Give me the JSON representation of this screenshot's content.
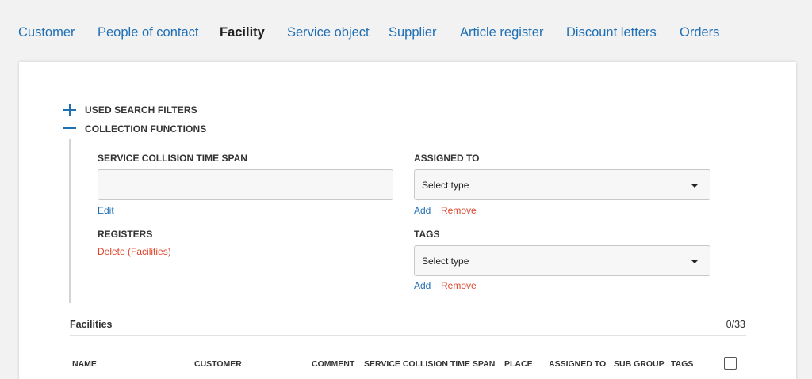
{
  "nav": {
    "tabs": [
      {
        "label": "Customer"
      },
      {
        "label": "People of contact"
      },
      {
        "label": "Facility"
      },
      {
        "label": "Service object"
      },
      {
        "label": "Supplier"
      },
      {
        "label": "Article register"
      },
      {
        "label": "Discount letters"
      },
      {
        "label": "Orders"
      }
    ],
    "active": "Facility"
  },
  "filters": {
    "used_search_filters": "USED SEARCH FILTERS",
    "collection_functions": "COLLECTION FUNCTIONS"
  },
  "collection": {
    "service_collision": {
      "label": "SERVICE COLLISION TIME SPAN",
      "value": "",
      "edit_link": "Edit"
    },
    "assigned_to": {
      "label": "ASSIGNED TO",
      "select_value": "Select type",
      "add": "Add",
      "remove": "Remove"
    },
    "registers": {
      "label": "REGISTERS",
      "delete_link": "Delete (Facilities)"
    },
    "tags": {
      "label": "TAGS",
      "select_value": "Select type",
      "add": "Add",
      "remove": "Remove"
    }
  },
  "facilities": {
    "title": "Facilities",
    "count": "0/33",
    "columns": [
      "NAME",
      "CUSTOMER",
      "COMMENT",
      "SERVICE COLLISION TIME SPAN",
      "PLACE",
      "ASSIGNED TO",
      "SUB GROUP",
      "TAGS"
    ]
  },
  "colors": {
    "link_blue": "#1f6fb5",
    "link_red": "#e0442a",
    "background": "#f2f2f2"
  }
}
